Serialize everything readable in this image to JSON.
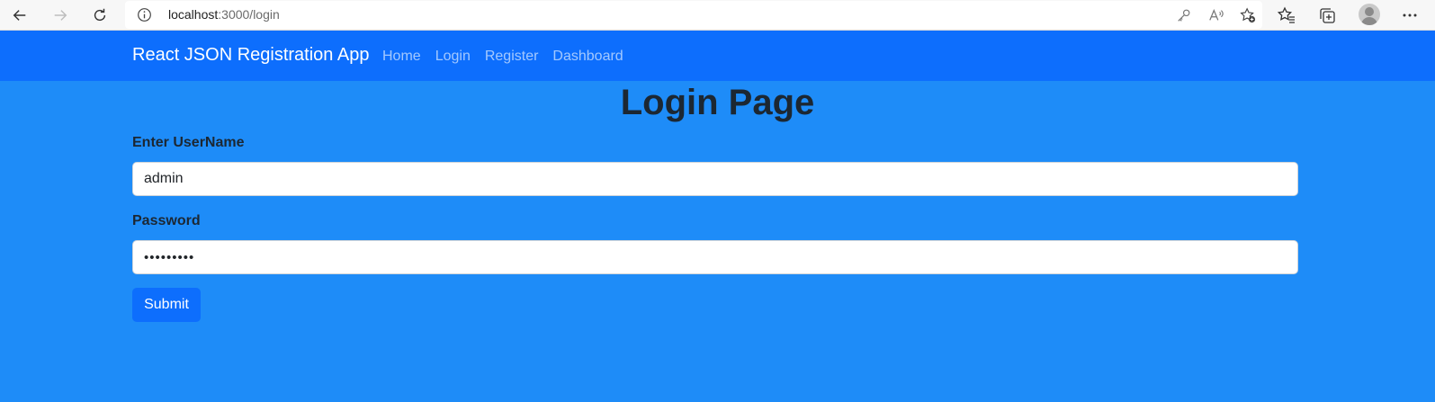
{
  "browser": {
    "url_host": "localhost",
    "url_path": ":3000/login"
  },
  "navbar": {
    "brand": "React JSON Registration App",
    "links": [
      {
        "label": "Home"
      },
      {
        "label": "Login"
      },
      {
        "label": "Register"
      },
      {
        "label": "Dashboard"
      }
    ]
  },
  "main": {
    "title": "Login Page",
    "username": {
      "label": "Enter UserName",
      "value": "admin"
    },
    "password": {
      "label": "Password",
      "value": "•••••••••"
    },
    "submit_label": "Submit"
  },
  "colors": {
    "page_background": "#1e8cf8",
    "navbar_background": "#0d6efd",
    "button_primary": "#0d6efd"
  },
  "icons": {
    "back": "arrow-left-icon",
    "forward": "arrow-right-icon",
    "refresh": "refresh-icon",
    "info": "info-icon",
    "key": "key-icon",
    "read_aloud": "read-aloud-icon",
    "add_favorite": "star-plus-icon",
    "favorites": "favorites-icon",
    "collections": "collections-icon",
    "profile": "avatar",
    "menu": "more-dots-icon"
  }
}
